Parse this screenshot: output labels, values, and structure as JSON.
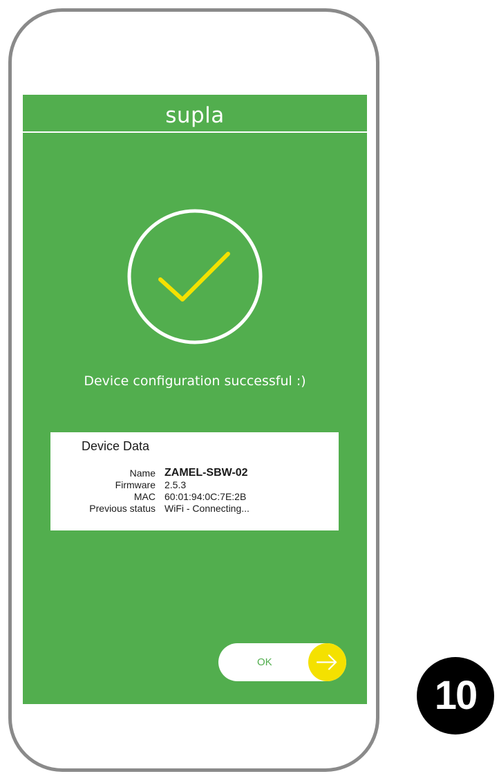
{
  "app": {
    "title": "supla"
  },
  "status": {
    "message": "Device configuration successful :)",
    "icon": "check-circle-icon"
  },
  "device_card": {
    "title": "Device Data",
    "rows": [
      {
        "label": "Name",
        "value": "ZAMEL-SBW-02"
      },
      {
        "label": "Firmware",
        "value": "2.5.3"
      },
      {
        "label": "MAC",
        "value": "60:01:94:0C:7E:2B"
      },
      {
        "label": "Previous status",
        "value": "WiFi - Connecting..."
      }
    ]
  },
  "ok_button": {
    "label": "OK",
    "icon": "arrow-right-icon"
  },
  "step_badge": {
    "number": "10"
  },
  "colors": {
    "screen_background": "#52ae4e",
    "check_mark": "#f4e100",
    "arrow_circle": "#f4e100",
    "phone_frame": "#8a8a8a",
    "badge_background": "#000000"
  }
}
